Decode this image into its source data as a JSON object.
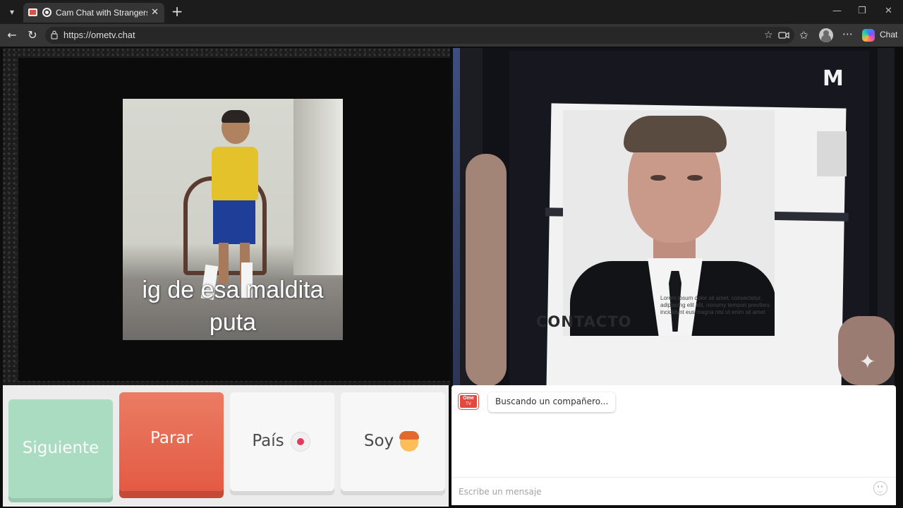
{
  "browser": {
    "tab": {
      "title": "Cam Chat with Strangers on OmeTV"
    },
    "address": {
      "url": "https://ometv.chat"
    },
    "copilot_label": "Chat",
    "icons": {
      "tab_menu": "chevron-down-icon",
      "new_tab": "plus-icon",
      "back": "back-arrow-icon",
      "reload": "reload-icon",
      "favorite": "star-icon",
      "camera": "camera-icon",
      "favorites": "favorites-icon",
      "profile": "profile-icon",
      "more": "more-icon",
      "minimize": "minimize-icon",
      "maximize": "maximize-icon",
      "close": "close-icon"
    }
  },
  "videos": {
    "left": {
      "caption": "ig de esa maldita puta"
    },
    "right": {
      "poster_heading": "CONTACTO",
      "poster_text": "Lorem ipsum dolor sit amet, consectetur, adipiscing elit elit, nonumy tempori previters incididunt eus magna nisi ut enim sit amet"
    }
  },
  "controls": {
    "next_label": "Siguiente",
    "stop_label": "Parar",
    "country_label": "País",
    "gender_label": "Soy"
  },
  "chat": {
    "logo_text": "Ome",
    "logo_sub": "TV",
    "status_message": "Buscando un compañero...",
    "input_placeholder": "Escribe un mensaje"
  },
  "colors": {
    "next_button": "#a9dcc0",
    "stop_button": "#e35a44",
    "country_dot": "#e33b5c",
    "ome_logo": "#e5483d"
  }
}
